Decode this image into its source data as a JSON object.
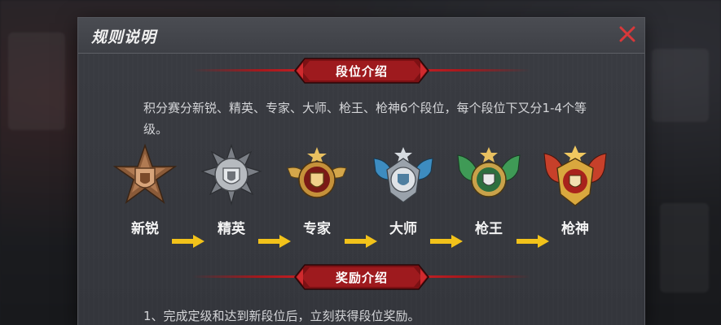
{
  "dialog": {
    "title": "规则说明",
    "close_icon": "close-x-icon",
    "accent_color": "#c22025"
  },
  "section_ranks": {
    "heading": "段位介绍",
    "description": "积分赛分新锐、精英、专家、大师、枪王、枪神6个段位，每个段位下又分1-4个等级。",
    "ranks": [
      {
        "label": "新锐",
        "icon": "bronze-star-medal-icon",
        "color": "#b07a52"
      },
      {
        "label": "精英",
        "icon": "silver-star-medal-icon",
        "color": "#a9adb3"
      },
      {
        "label": "专家",
        "icon": "gold-winged-medal-icon",
        "color": "#d4a64a"
      },
      {
        "label": "大师",
        "icon": "blue-winged-medal-icon",
        "color": "#4fa6d6"
      },
      {
        "label": "枪王",
        "icon": "green-winged-medal-icon",
        "color": "#4aa55e"
      },
      {
        "label": "枪神",
        "icon": "red-winged-medal-icon",
        "color": "#d0472c"
      }
    ],
    "arrow_icon": "yellow-arrow-right-icon",
    "arrow_color": "#f2c21a"
  },
  "section_rewards": {
    "heading": "奖励介绍",
    "rules": [
      "1、完成定级和达到新段位后，立刻获得段位奖励。"
    ]
  }
}
